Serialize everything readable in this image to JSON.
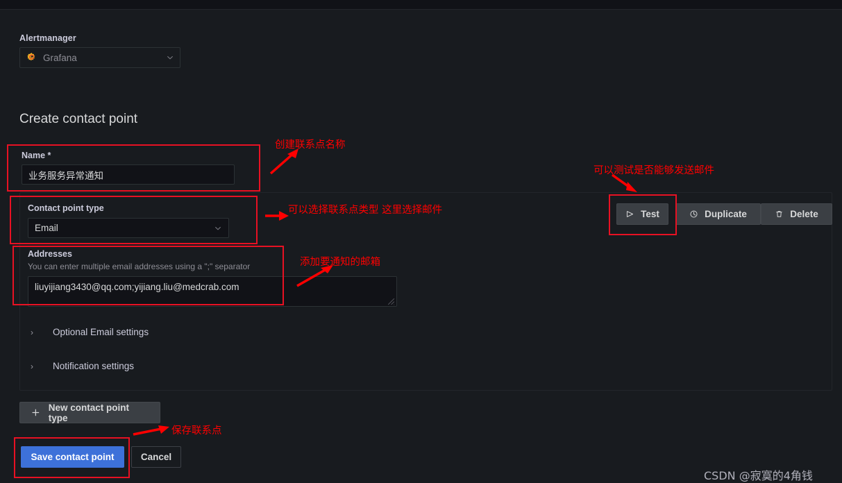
{
  "colors": {
    "page_bg": "#181b1f",
    "panel_bg": "#111217",
    "accent_blue": "#3d71d9",
    "annotation_red": "#ff0000",
    "grafana_orange": "#f05a28"
  },
  "alertmanager": {
    "label": "Alertmanager",
    "selected": "Grafana",
    "logo_icon": "grafana-logo-icon",
    "chevron_icon": "chevron-down-icon"
  },
  "page_title": "Create contact point",
  "form": {
    "name": {
      "label": "Name *",
      "value": "业务服务异常通知"
    },
    "contact_point_type": {
      "label": "Contact point type",
      "value": "Email",
      "chevron_icon": "chevron-down-icon"
    },
    "addresses": {
      "label": "Addresses",
      "help": "You can enter multiple email addresses using a \";\" separator",
      "value": "liuyijiang3430@qq.com;yijiang.liu@medcrab.com",
      "resize_icon": "resize-handle-icon"
    },
    "collapsible": [
      {
        "caret": "›",
        "label": "Optional Email settings"
      },
      {
        "caret": "›",
        "label": "Notification settings"
      }
    ]
  },
  "actions": {
    "test": {
      "label": "Test",
      "icon": "send-triangle-icon"
    },
    "duplicate": {
      "label": "Duplicate",
      "icon": "copy-icon"
    },
    "delete": {
      "label": "Delete",
      "icon": "trash-icon"
    }
  },
  "footer": {
    "new_contact_point_type": {
      "label": "New contact point type",
      "icon": "plus-icon"
    },
    "save": "Save contact point",
    "cancel": "Cancel"
  },
  "annotations": [
    {
      "text": "创建联系点名称"
    },
    {
      "text": "可以选择联系点类型 这里选择邮件"
    },
    {
      "text": "添加要通知的邮箱"
    },
    {
      "text": "可以测试是否能够发送邮件"
    },
    {
      "text": "保存联系点"
    }
  ],
  "watermark": "CSDN @寂寞的4角钱"
}
